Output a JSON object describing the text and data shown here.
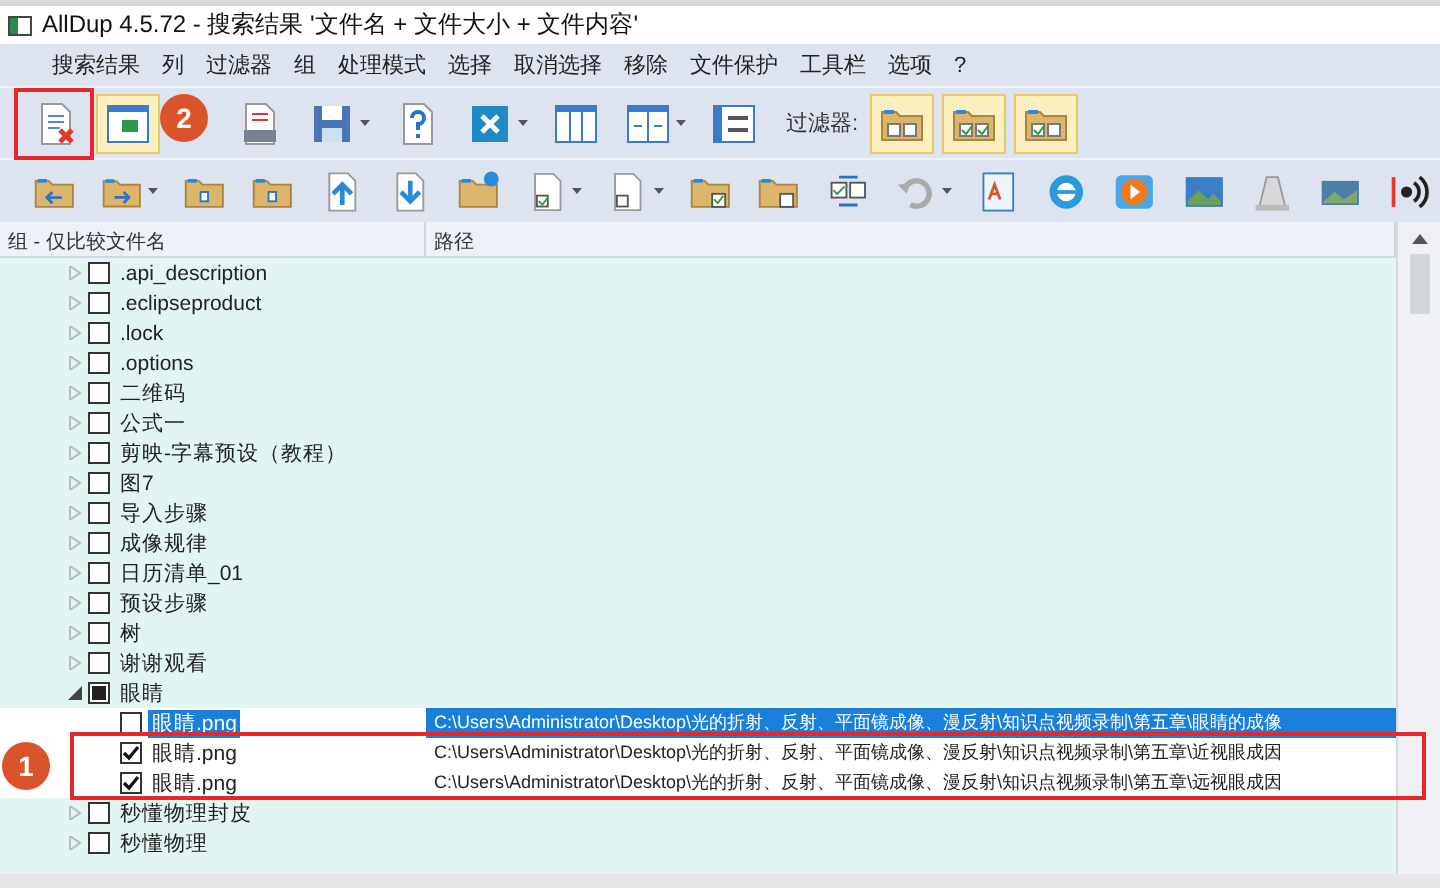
{
  "window": {
    "title": "AllDup 4.5.72 - 搜索结果 '文件名 + 文件大小 + 文件内容'"
  },
  "menu": [
    "搜索结果",
    "列",
    "过滤器",
    "组",
    "处理模式",
    "选择",
    "取消选择",
    "移除",
    "文件保护",
    "工具栏",
    "选项",
    "?"
  ],
  "toolbar_1": [
    {
      "kind": "doc-x",
      "active": false
    },
    {
      "kind": "columns",
      "active": true
    },
    {
      "kind": "log",
      "active": false
    },
    {
      "kind": "save",
      "active": false,
      "dropdown": true
    },
    {
      "kind": "help",
      "active": false
    },
    {
      "kind": "close",
      "active": false,
      "dropdown": true
    },
    {
      "kind": "columns3",
      "active": false
    },
    {
      "kind": "columns-split",
      "active": false,
      "dropdown": true
    },
    {
      "kind": "kbmb",
      "active": false
    },
    {
      "kind": "label",
      "text": "过滤器:"
    },
    {
      "kind": "filter-empty",
      "active": true
    },
    {
      "kind": "filter-checked",
      "active": true
    },
    {
      "kind": "filter-partial",
      "active": true
    }
  ],
  "toolbar_2": [
    {
      "kind": "folder-back",
      "active": false
    },
    {
      "kind": "folder-forward",
      "active": false,
      "dropdown": true
    },
    {
      "kind": "folder-in",
      "active": false
    },
    {
      "kind": "folder-out",
      "active": false
    },
    {
      "kind": "arrow-up",
      "active": false
    },
    {
      "kind": "arrow-down",
      "active": false
    },
    {
      "kind": "folder-gear",
      "active": false
    },
    {
      "kind": "doc-check",
      "active": false,
      "dropdown": true
    },
    {
      "kind": "doc-empty",
      "active": false,
      "dropdown": true
    },
    {
      "kind": "folder-check",
      "active": false
    },
    {
      "kind": "folder-empty",
      "active": false
    },
    {
      "kind": "swap",
      "active": false
    },
    {
      "kind": "undo",
      "active": false,
      "dropdown": true,
      "disabled": true
    },
    {
      "kind": "text-doc",
      "active": false
    },
    {
      "kind": "browser",
      "active": false
    },
    {
      "kind": "play",
      "active": false
    },
    {
      "kind": "image",
      "active": false
    },
    {
      "kind": "cone",
      "active": false
    },
    {
      "kind": "exif",
      "active": false
    },
    {
      "kind": "speaker",
      "active": false
    }
  ],
  "table": {
    "columns": [
      "组 - 仅比较文件名",
      "路径"
    ],
    "groups": [
      {
        "name": ".api_description",
        "checked": false,
        "partial": false,
        "expanded": false
      },
      {
        "name": ".eclipseproduct",
        "checked": false,
        "partial": false,
        "expanded": false
      },
      {
        "name": ".lock",
        "checked": false,
        "partial": false,
        "expanded": false
      },
      {
        "name": ".options",
        "checked": false,
        "partial": false,
        "expanded": false
      },
      {
        "name": "二维码",
        "checked": false,
        "partial": false,
        "expanded": false
      },
      {
        "name": "公式一",
        "checked": false,
        "partial": false,
        "expanded": false
      },
      {
        "name": "剪映-字幕预设（教程）",
        "checked": false,
        "partial": false,
        "expanded": false
      },
      {
        "name": "图7",
        "checked": false,
        "partial": false,
        "expanded": false
      },
      {
        "name": "导入步骤",
        "checked": false,
        "partial": false,
        "expanded": false
      },
      {
        "name": "成像规律",
        "checked": false,
        "partial": false,
        "expanded": false
      },
      {
        "name": "日历清单_01",
        "checked": false,
        "partial": false,
        "expanded": false
      },
      {
        "name": "预设步骤",
        "checked": false,
        "partial": false,
        "expanded": false
      },
      {
        "name": "树",
        "checked": false,
        "partial": false,
        "expanded": false
      },
      {
        "name": "谢谢观看",
        "checked": false,
        "partial": false,
        "expanded": false
      },
      {
        "name": "眼睛",
        "checked": false,
        "partial": true,
        "expanded": true,
        "children": [
          {
            "name": "眼睛.png",
            "path": "C:\\Users\\Administrator\\Desktop\\光的折射、反射、平面镜成像、漫反射\\知识点视频录制\\第五章\\眼睛的成像",
            "checked": false,
            "selected": true
          },
          {
            "name": "眼睛.png",
            "path": "C:\\Users\\Administrator\\Desktop\\光的折射、反射、平面镜成像、漫反射\\知识点视频录制\\第五章\\近视眼成因",
            "checked": true,
            "selected": false
          },
          {
            "name": "眼睛.png",
            "path": "C:\\Users\\Administrator\\Desktop\\光的折射、反射、平面镜成像、漫反射\\知识点视频录制\\第五章\\远视眼成因",
            "checked": true,
            "selected": false
          }
        ]
      },
      {
        "name": "秒懂物理封皮",
        "checked": false,
        "partial": false,
        "expanded": false
      },
      {
        "name": "秒懂物理",
        "checked": false,
        "partial": false,
        "expanded": false
      }
    ]
  },
  "annotations": [
    {
      "label": "2"
    },
    {
      "label": "1"
    }
  ]
}
